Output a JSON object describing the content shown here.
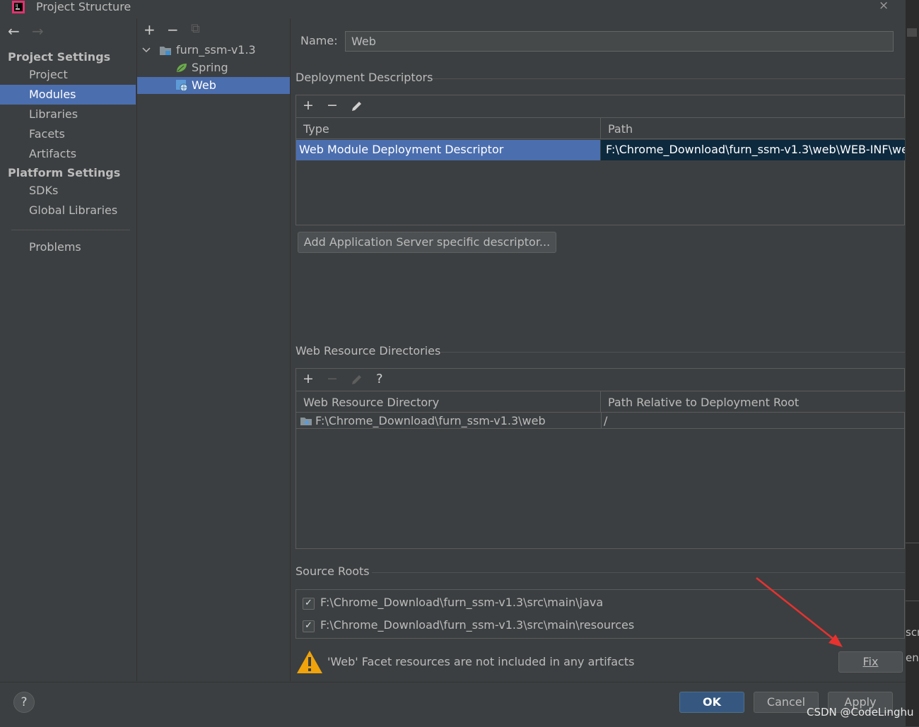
{
  "window": {
    "title": "Project Structure",
    "close_glyph": "×"
  },
  "nav": {
    "back_glyph": "←",
    "forward_glyph": "→",
    "project_settings_heading": "Project Settings",
    "project_settings_items": [
      "Project",
      "Modules",
      "Libraries",
      "Facets",
      "Artifacts"
    ],
    "selected_item": "Modules",
    "platform_settings_heading": "Platform Settings",
    "platform_settings_items": [
      "SDKs",
      "Global Libraries"
    ],
    "problems": "Problems"
  },
  "tree": {
    "add_glyph": "+",
    "remove_glyph": "−",
    "copy_glyph": "⧉",
    "module": "furn_ssm-v1.3",
    "children": [
      "Spring",
      "Web"
    ],
    "selected": "Web"
  },
  "name_field": {
    "label": "Name:",
    "value": "Web"
  },
  "deployment": {
    "title": "Deployment Descriptors",
    "col_type": "Type",
    "col_path": "Path",
    "row_type": "Web Module Deployment Descriptor",
    "row_path": "F:\\Chrome_Download\\furn_ssm-v1.3\\web\\WEB-INF\\we",
    "add_server_button": "Add Application Server specific descriptor..."
  },
  "web_resources": {
    "title": "Web Resource Directories",
    "help_glyph": "?",
    "col_dir": "Web Resource Directory",
    "col_rel": "Path Relative to Deployment Root",
    "row_dir": "F:\\Chrome_Download\\furn_ssm-v1.3\\web",
    "row_rel": "/"
  },
  "source_roots": {
    "title": "Source Roots",
    "check_glyph": "✓",
    "items": [
      {
        "path": "F:\\Chrome_Download\\furn_ssm-v1.3\\src\\main\\java",
        "checked": true
      },
      {
        "path": "F:\\Chrome_Download\\furn_ssm-v1.3\\src\\main\\resources",
        "checked": true
      }
    ]
  },
  "warning": {
    "message": "'Web' Facet resources are not included in any artifacts",
    "fix_button": "Fix"
  },
  "footer": {
    "help_glyph": "?",
    "ok": "OK",
    "cancel": "Cancel",
    "apply": "Apply"
  },
  "background_fragments": {
    "frag1": "scr",
    "frag2": "en"
  },
  "watermark": "CSDN @CodeLinghu",
  "colors": {
    "selection": "#4b6eaf",
    "annotation_arrow": "#e8322f",
    "warning": "#f0a30a"
  }
}
